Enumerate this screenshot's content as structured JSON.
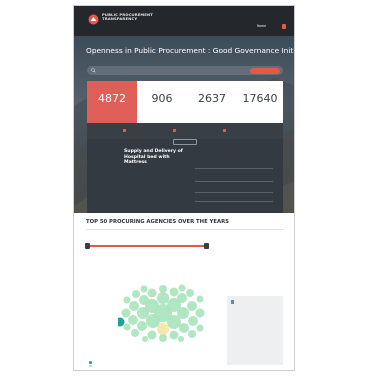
{
  "header": {
    "logo_line1": "PUBLIC PROCUREMENT",
    "logo_line2": "TRANSPARENCY",
    "logo_line3": "",
    "top_links": [
      "",
      ""
    ],
    "nav": [
      {
        "label": "Home",
        "active": true
      },
      {
        "label": "",
        "active": false
      },
      {
        "label": "",
        "active": false
      },
      {
        "label": "",
        "active": false
      }
    ],
    "language_button": ""
  },
  "hero": {
    "title": "Openness in Public Procurement : Good Governance Initiative",
    "subtitle": ""
  },
  "search": {
    "placeholder": "",
    "advanced_button": ""
  },
  "stats": [
    {
      "value": "4872",
      "label": "",
      "caption": "",
      "more": ""
    },
    {
      "value": "906",
      "label": "",
      "caption": "",
      "more": ""
    },
    {
      "value": "2637",
      "label": "",
      "caption": "",
      "more": ""
    },
    {
      "value": "17640",
      "label": "",
      "caption": "",
      "more": ""
    }
  ],
  "tabs": [
    {
      "label": "",
      "count": ""
    },
    {
      "label": "",
      "count": ""
    },
    {
      "label": "",
      "count": ""
    }
  ],
  "results": {
    "sort_button": "",
    "tender_title": "Supply and Delivery of Hospital bed with Mattress",
    "fields": [
      {
        "key": "",
        "value": ""
      },
      {
        "key": "",
        "value": ""
      },
      {
        "key": "",
        "value": ""
      },
      {
        "key": "",
        "value": ""
      }
    ]
  },
  "agencies": {
    "title": "TOP 50 PROCURING AGENCIES OVER THE YEARS",
    "hint": "",
    "hint_red": "",
    "years": [
      "",
      "",
      "",
      "",
      "",
      ""
    ],
    "range": [
      0,
      1
    ],
    "filters": [
      {
        "label": "",
        "checked": true
      },
      {
        "label": "",
        "checked": false
      },
      {
        "label": "",
        "checked": false
      },
      {
        "label": "",
        "checked": false
      },
      {
        "label": "",
        "checked": false
      },
      {
        "label": "",
        "checked": false
      },
      {
        "label": "",
        "checked": false
      },
      {
        "label": "",
        "checked": false
      }
    ],
    "legend": [
      {
        "label": "",
        "color": "#1aa597"
      },
      {
        "label": "",
        "color": "#a8e3bb"
      }
    ]
  },
  "colors": {
    "accent": "#e2584a",
    "bubble": "#a8e3bb",
    "bubble_highlight": "#1aa597",
    "bubble_marked": "#f3e6a2"
  }
}
